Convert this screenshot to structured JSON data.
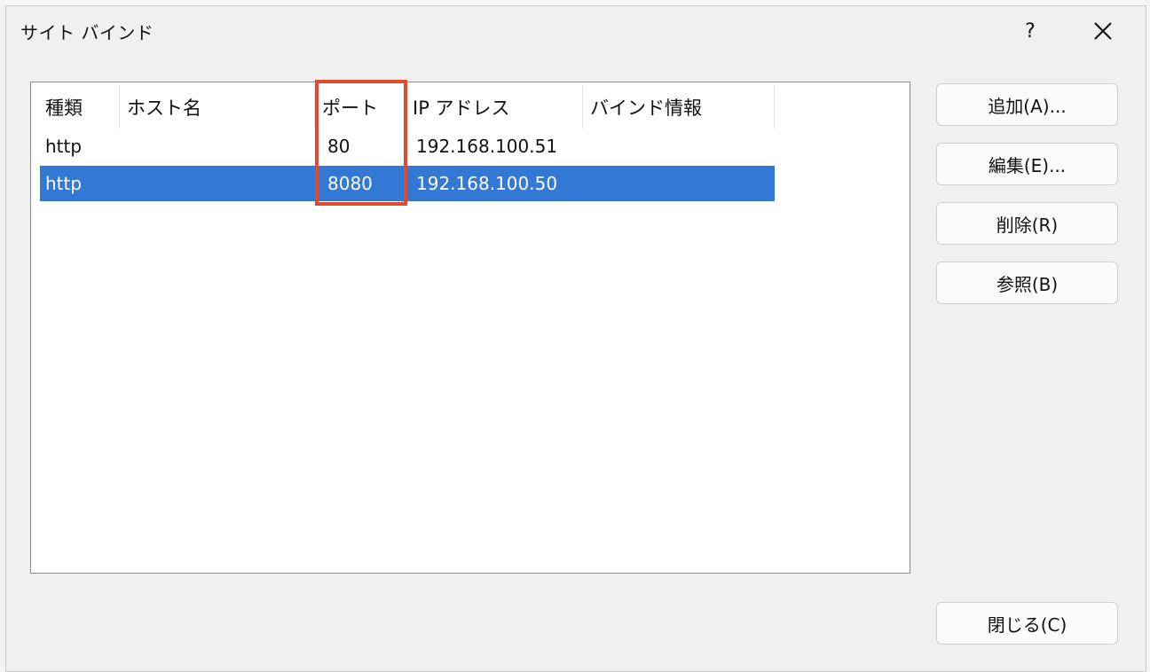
{
  "dialog": {
    "title": "サイト バインド",
    "help_label": "?"
  },
  "list": {
    "columns": [
      "種類",
      "ホスト名",
      "ポート",
      "IP アドレス",
      "バインド情報"
    ],
    "rows": [
      {
        "type": "http",
        "host": "",
        "port": "80",
        "ip": "192.168.100.51",
        "binding": "",
        "selected": false
      },
      {
        "type": "http",
        "host": "",
        "port": "8080",
        "ip": "192.168.100.50",
        "binding": "",
        "selected": true
      }
    ]
  },
  "buttons": {
    "add": "追加(A)...",
    "edit": "編集(E)...",
    "delete": "削除(R)",
    "browse": "参照(B)",
    "close": "閉じる(C)"
  },
  "colors": {
    "selection": "#3478d6",
    "highlight_box": "#e04a2e"
  },
  "icons": {
    "close": "close-icon"
  }
}
